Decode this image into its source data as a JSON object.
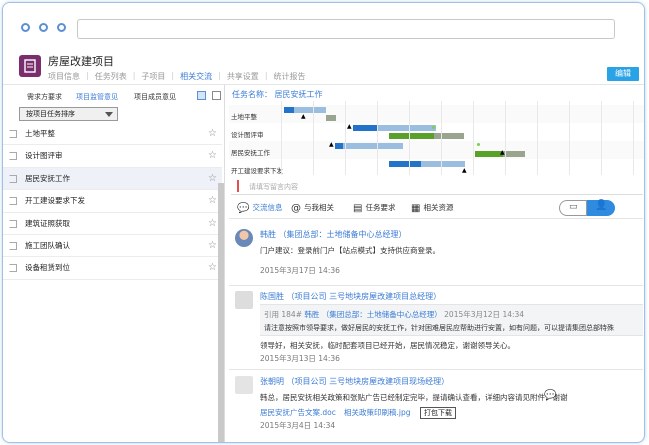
{
  "project": {
    "title": "房屋改建项目",
    "edit_label": "编辑",
    "nav": [
      "项目信息",
      "任务列表",
      "子项目",
      "相关交流",
      "共享设置",
      "统计报告"
    ],
    "nav_active": 3
  },
  "left": {
    "tabs": [
      "需求方要求",
      "项目监管意见",
      "项目成员意见"
    ],
    "active_tab": 1,
    "sort_label": "按项目任务排序",
    "tasks": [
      "土地平整",
      "设计图评审",
      "居民安抚工作",
      "开工建设要求下发",
      "建筑证照获取",
      "施工团队确认",
      "设备租赁到位"
    ],
    "selected_task": 2
  },
  "gantt": {
    "title": "任务名称： 居民安抚工作",
    "rows": [
      "土地平整",
      "设计图评审",
      "居民安抚工作",
      "开工建设要求下发"
    ]
  },
  "comment_placeholder": "请填写留言内容",
  "content_tabs": [
    "交流信息",
    "与我相关",
    "任务要求",
    "相关资源"
  ],
  "posts": [
    {
      "author": "韩胜",
      "org": "（集团总部：土地储备中心总经理）",
      "body": "门户建议：登录前门户【站点模式】支持供应商登录。",
      "date": "2015年3月17日  14:36"
    },
    {
      "author": "陈国胜",
      "org": "（项目公司 三号地块房屋改建项目总经理）",
      "quote_prefix": "引用 184#",
      "quote_author": "韩胜",
      "quote_org": "（集团总部：土地储备中心总经理）",
      "quote_date": "2015年3月12日  14:34",
      "quote_text": "请注意按照市领导要求，做好居民的安抚工作，针对困难居民应帮助进行安置，如有问题，可以提请集团总部特殊",
      "body": "领导好，相关安抚，临时配套项目已经开始，居民情况稳定，谢谢领导关心。",
      "date": "2015年3月13日  14:36"
    },
    {
      "author": "张朝明",
      "org": "（项目公司 三号地块房屋改建项目现场经理）",
      "body": "韩总，居民安抚相关政策和张贴广告已经制定完毕，提请确认查看，详细内容请见附件，谢谢",
      "attachments": [
        "居民安抚广告文案.doc",
        "相关政策印刷稿.jpg"
      ],
      "download_label": "打包下载",
      "date": "2015年3月4日  14:34"
    }
  ]
}
